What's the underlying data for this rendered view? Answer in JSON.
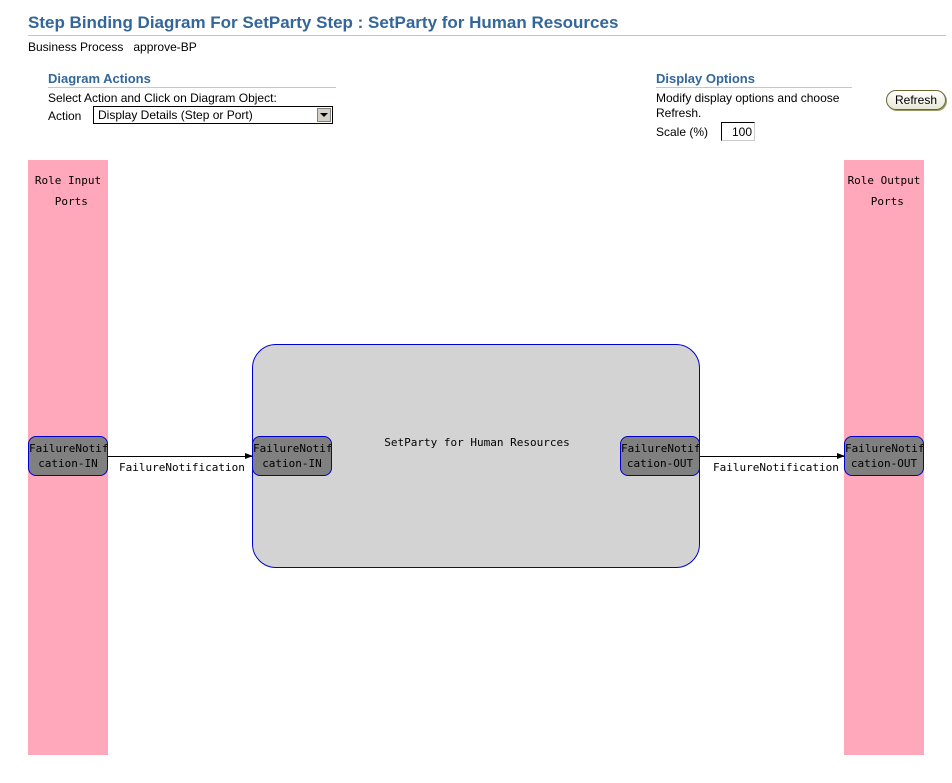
{
  "header": {
    "title": "Step Binding Diagram For SetParty Step : SetParty for Human Resources",
    "business_process_label": "Business Process",
    "business_process_value": "approve-BP"
  },
  "diagram_actions": {
    "heading": "Diagram Actions",
    "instruction": "Select Action and Click on Diagram Object:",
    "action_label": "Action",
    "action_selected": "Display Details (Step or Port)"
  },
  "display_options": {
    "heading": "Display Options",
    "instruction_line1": "Modify display options and choose",
    "instruction_line2": "Refresh.",
    "refresh_label": "Refresh",
    "scale_label": "Scale (%)",
    "scale_value": "100"
  },
  "diagram": {
    "input_column_label": "Role Input\n Ports",
    "output_column_label": "Role Output\n Ports",
    "step_name": "SetParty for Human Resources",
    "role_input_port": {
      "line1": "FailureNotifi",
      "line2": "cation-IN"
    },
    "step_input_port": {
      "line1": "FailureNotifi",
      "line2": "cation-IN"
    },
    "step_output_port": {
      "line1": "FailureNotifi",
      "line2": "cation-OUT"
    },
    "role_output_port": {
      "line1": "FailureNotifi",
      "line2": "cation-OUT"
    },
    "input_connection_label": "FailureNotification",
    "output_connection_label": "FailureNotification"
  },
  "colors": {
    "heading": "#336699",
    "role_column": "#ffa8bc",
    "step_fill": "#d3d3d3",
    "port_fill": "#808080",
    "border": "#0000cc"
  }
}
